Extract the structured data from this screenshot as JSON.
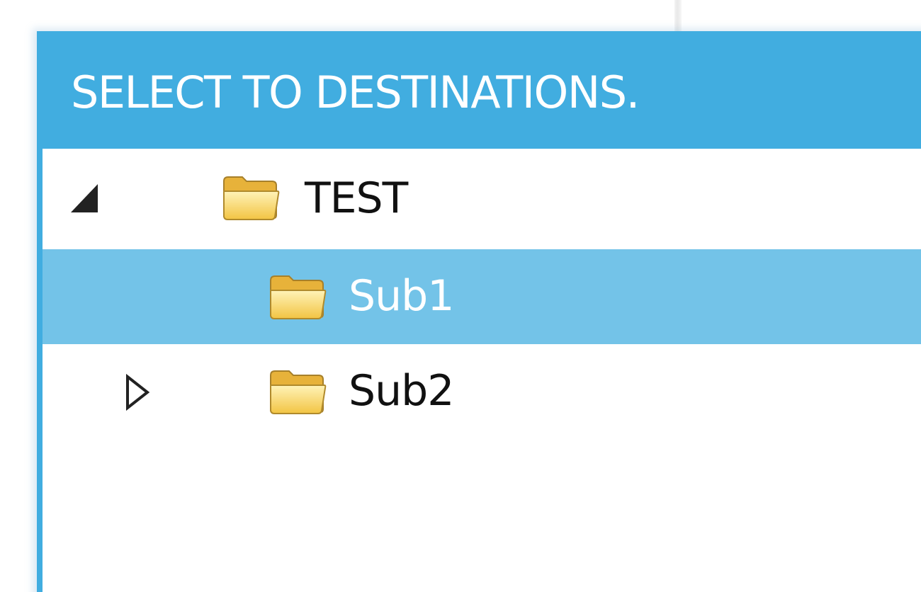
{
  "dialog": {
    "title": "SELECT TO DESTINATIONS."
  },
  "tree": {
    "root": {
      "label": "TEST",
      "expanded": true,
      "icon": "folder-icon",
      "children": [
        {
          "label": "Sub1",
          "selected": true,
          "has_children": false,
          "icon": "folder-icon"
        },
        {
          "label": "Sub2",
          "selected": false,
          "has_children": true,
          "expanded": false,
          "icon": "folder-icon"
        }
      ]
    }
  },
  "colors": {
    "header": "#41ade0",
    "selection": "#73c3e8",
    "folder": "#f5c94a"
  }
}
